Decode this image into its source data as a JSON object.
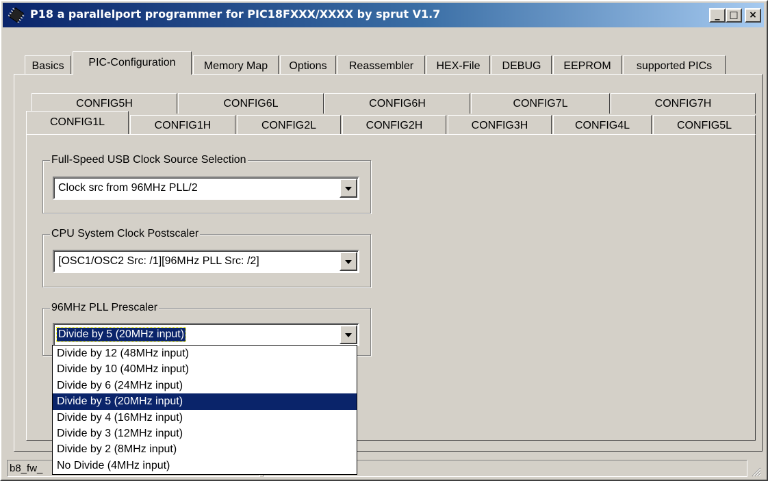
{
  "window": {
    "title": "P18  a parallelport programmer for PIC18FXXX/XXXX  by sprut V1.7",
    "minimize_label": "_",
    "maximize_label": "□",
    "close_label": "×"
  },
  "main_tabs": [
    {
      "label": "Basics",
      "active": false
    },
    {
      "label": "PIC-Configuration",
      "active": true
    },
    {
      "label": "Memory Map",
      "active": false
    },
    {
      "label": "Options",
      "active": false
    },
    {
      "label": "Reassembler",
      "active": false
    },
    {
      "label": "HEX-File",
      "active": false
    },
    {
      "label": "DEBUG",
      "active": false
    },
    {
      "label": "EEPROM",
      "active": false
    },
    {
      "label": "supported PICs",
      "active": false
    }
  ],
  "config_tabs_row1": [
    {
      "label": "CONFIG5H"
    },
    {
      "label": "CONFIG6L"
    },
    {
      "label": "CONFIG6H"
    },
    {
      "label": "CONFIG7L"
    },
    {
      "label": "CONFIG7H"
    }
  ],
  "config_tabs_row2": [
    {
      "label": "CONFIG1L",
      "active": true
    },
    {
      "label": "CONFIG1H"
    },
    {
      "label": "CONFIG2L"
    },
    {
      "label": "CONFIG2H"
    },
    {
      "label": "CONFIG3H"
    },
    {
      "label": "CONFIG4L"
    },
    {
      "label": "CONFIG5L"
    }
  ],
  "groups": {
    "usb_clock": {
      "label": "Full-Speed USB Clock Source Selection",
      "value": "Clock src from 96MHz PLL/2"
    },
    "cpu_postscaler": {
      "label": "CPU System Clock Postscaler",
      "value": "[OSC1/OSC2 Src: /1][96MHz PLL Src: /2]"
    },
    "pll_prescaler": {
      "label": "96MHz PLL Prescaler",
      "value": "Divide by 5 (20MHz input)",
      "options": [
        "Divide by 12 (48MHz input)",
        "Divide by 10 (40MHz input)",
        "Divide by 6 (24MHz input)",
        "Divide by 5 (20MHz input)",
        "Divide by 4 (16MHz input)",
        "Divide by 3 (12MHz input)",
        "Divide by 2 (8MHz input)",
        "No Divide (4MHz input)"
      ],
      "highlighted_index": 3
    }
  },
  "status": {
    "pane1": "b8_fw_",
    "pane2": ""
  },
  "colors": {
    "face": "#d4d0c8",
    "titlebar_start": "#0a246a",
    "titlebar_end": "#a6caf0",
    "selection": "#0a246a"
  },
  "icons": {
    "app": "chip-icon",
    "combo": "chevron-down-icon",
    "grip": "resize-grip-icon"
  }
}
